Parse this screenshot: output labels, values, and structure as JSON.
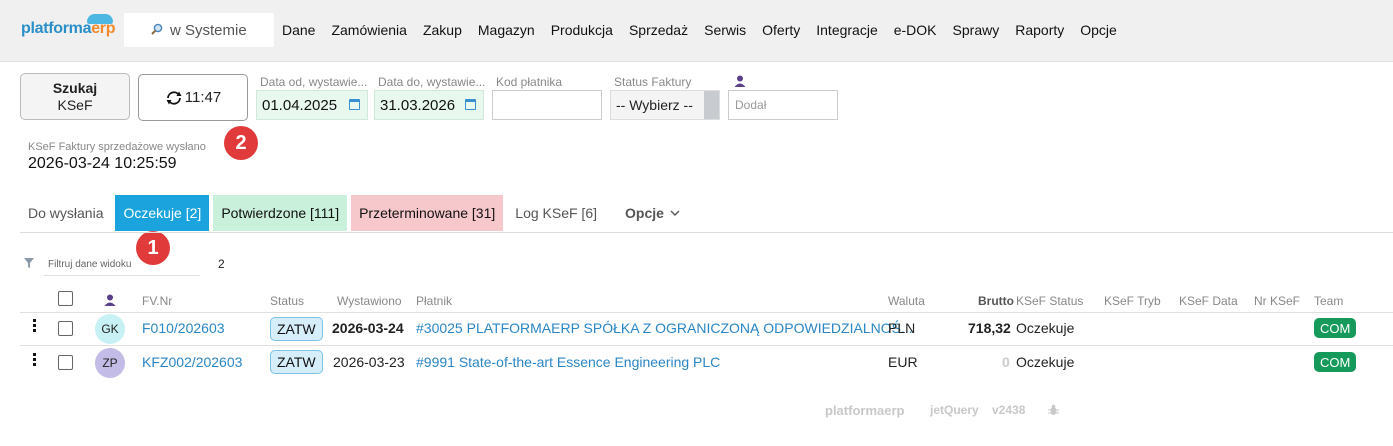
{
  "topbar": {
    "logo": {
      "part1": "platforma",
      "part2": "erp"
    },
    "search": {
      "value": "w Systemie",
      "icon": "magnifier-icon"
    },
    "menu": [
      "Dane",
      "Zamówienia",
      "Zakup",
      "Magazyn",
      "Produkcja",
      "Sprzedaż",
      "Serwis",
      "Oferty",
      "Integracje",
      "e-DOK",
      "Sprawy",
      "Raporty",
      "Opcje"
    ]
  },
  "filters": {
    "search_button": {
      "line1": "Szukaj",
      "line2": "KSeF"
    },
    "refresh_button": {
      "time": "11:47",
      "icon": "refresh-icon"
    },
    "date_from": {
      "label": "Data od, wystawie...",
      "value": "01.04.2025"
    },
    "date_to": {
      "label": "Data do, wystawie...",
      "value": "31.03.2026"
    },
    "payer_code": {
      "label": "Kod płatnika",
      "value": ""
    },
    "invoice_status": {
      "label": "Status Faktury",
      "value": "-- Wybierz --"
    },
    "added_by": {
      "icon": "user-icon",
      "placeholder": "Dodał"
    }
  },
  "ksef_sent": {
    "label": "KSeF Faktury sprzedażowe wysłano",
    "datetime": "2026-03-24 10:25:59"
  },
  "badges": {
    "badge1": "1",
    "badge2": "2"
  },
  "tabs": [
    {
      "label": "Do wysłania"
    },
    {
      "label": "Oczekuje [2]"
    },
    {
      "label": "Potwierdzone [111]"
    },
    {
      "label": "Przeterminowane [31]"
    },
    {
      "label": "Log KSeF [6]"
    },
    {
      "label": "Opcje"
    }
  ],
  "view_filter": {
    "placeholder": "Filtruj dane widoku",
    "count": "2"
  },
  "table": {
    "headers": {
      "fvnr": "FV.Nr",
      "status": "Status",
      "issued": "Wystawiono",
      "payer": "Płatnik",
      "currency": "Waluta",
      "gross": "Brutto",
      "ksef_status": "KSeF Status",
      "ksef_mode": "KSeF Tryb",
      "ksef_date": "KSeF Data",
      "ksef_nr": "Nr KSeF",
      "team": "Team"
    },
    "rows": [
      {
        "avatar": "GK",
        "fvnr": "F010/202603",
        "status": "ZATW",
        "issued": "2026-03-24",
        "payer": "#30025 PLATFORMAERP SPÓŁKA Z OGRANICZONĄ ODPOWIEDZIALNOŚ...",
        "currency": "PLN",
        "gross": "718,32",
        "ksef_status": "Oczekuje",
        "team": "COM"
      },
      {
        "avatar": "ZP",
        "fvnr": "KFZ002/202603",
        "status": "ZATW",
        "issued": "2026-03-23",
        "payer": "#9991 State-of-the-art Essence Engineering PLC",
        "currency": "EUR",
        "gross": "0",
        "ksef_status": "Oczekuje",
        "team": "COM"
      }
    ]
  },
  "footer": {
    "brand1": "platforma",
    "brand2": "erp",
    "jetquery": "jetQuery",
    "version": "v2438",
    "icon": "bug-icon"
  },
  "colors": {
    "accent": "#1aa3dd",
    "link": "#2a86c5",
    "team": "#159a5b",
    "badge": "#e03a3a",
    "tab_green": "#c9f0da",
    "tab_red": "#f6c8cb",
    "date_bg": "#e8f8ee"
  }
}
